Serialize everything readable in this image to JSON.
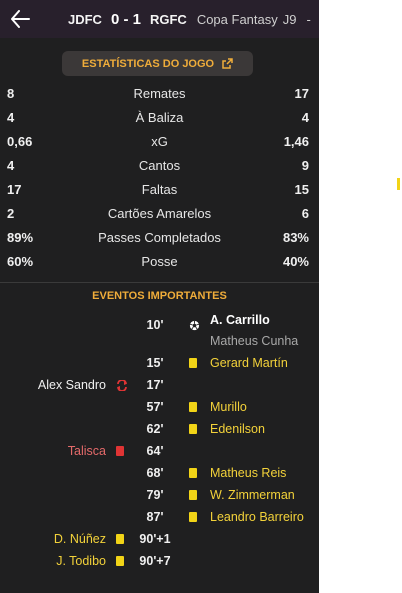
{
  "header": {
    "home_abbr": "JDFC",
    "score": "0 - 1",
    "away_abbr": "RGFC",
    "competition": "Copa Fantasy",
    "round": "J9",
    "separator": "-"
  },
  "stats_button_label": "ESTATÍSTICAS DO JOGO",
  "stats": [
    {
      "home": "8",
      "label": "Remates",
      "away": "17"
    },
    {
      "home": "4",
      "label": "À Baliza",
      "away": "4"
    },
    {
      "home": "0,66",
      "label": "xG",
      "away": "1,46"
    },
    {
      "home": "4",
      "label": "Cantos",
      "away": "9"
    },
    {
      "home": "17",
      "label": "Faltas",
      "away": "15"
    },
    {
      "home": "2",
      "label": "Cartões Amarelos",
      "away": "6"
    },
    {
      "home": "89%",
      "label": "Passes Completados",
      "away": "83%"
    },
    {
      "home": "60%",
      "label": "Posse",
      "away": "40%"
    }
  ],
  "events_title": "EVENTOS IMPORTANTES",
  "events": [
    {
      "minute": "10'",
      "side": "away",
      "type": "goal",
      "player": "A. Carrillo",
      "assist": "Matheus Cunha"
    },
    {
      "minute": "15'",
      "side": "away",
      "type": "yellow",
      "player": "Gerard Martín"
    },
    {
      "minute": "17'",
      "side": "home",
      "type": "substitution",
      "player": "Alex Sandro"
    },
    {
      "minute": "57'",
      "side": "away",
      "type": "yellow",
      "player": "Murillo"
    },
    {
      "minute": "62'",
      "side": "away",
      "type": "yellow",
      "player": "Edenilson"
    },
    {
      "minute": "64'",
      "side": "home",
      "type": "red",
      "player": "Talisca"
    },
    {
      "minute": "68'",
      "side": "away",
      "type": "yellow",
      "player": "Matheus Reis"
    },
    {
      "minute": "79'",
      "side": "away",
      "type": "yellow",
      "player": "W. Zimmerman"
    },
    {
      "minute": "87'",
      "side": "away",
      "type": "yellow",
      "player": "Leandro Barreiro"
    },
    {
      "minute": "90'+1",
      "side": "home",
      "type": "yellow",
      "player": "D. Núñez"
    },
    {
      "minute": "90'+7",
      "side": "home",
      "type": "yellow",
      "player": "J. Todibo"
    }
  ],
  "colors": {
    "accent": "#f0ad3a",
    "yellow_card": "#f2d417",
    "red_card": "#e03434",
    "red_name": "#e46a6a",
    "panel_bg": "#1f1f20",
    "header_bg": "#28202c"
  },
  "icons": {
    "back": "arrow-left-icon",
    "external": "external-link-icon",
    "goal": "football-icon",
    "yellow": "yellow-card-icon",
    "red": "red-card-icon",
    "substitution": "substitution-icon"
  }
}
